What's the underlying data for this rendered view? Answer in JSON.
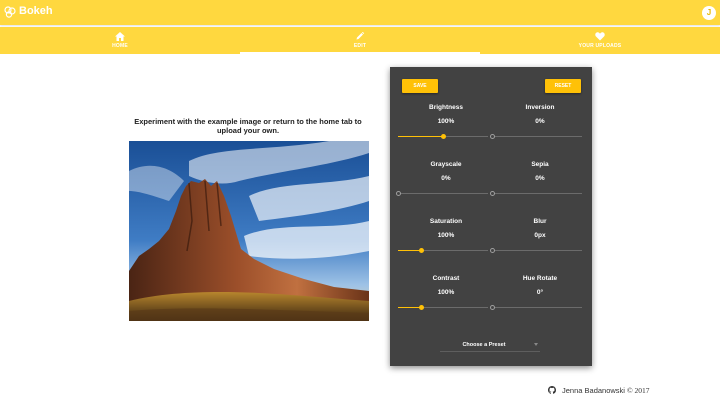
{
  "app": {
    "brand": "Bokeh",
    "logo_icon": "bokeh-logo-icon",
    "avatar_initial": "J"
  },
  "colors": {
    "primary": "#ffd83f",
    "accent": "#ffc107",
    "panel": "#424242"
  },
  "tabs": [
    {
      "label": "HOME",
      "icon": "home-icon",
      "active": false
    },
    {
      "label": "EDIT",
      "icon": "pencil-icon",
      "active": true
    },
    {
      "label": "YOUR UPLOADS",
      "icon": "heart-icon",
      "active": false
    }
  ],
  "main": {
    "intro": "Experiment with the example image or return to the home tab to upload your own.",
    "image_alt_icon": "rock-landscape-image"
  },
  "editor": {
    "save_label": "SAVE",
    "reset_label": "RESET",
    "controls": [
      {
        "label": "Brightness",
        "value": "100%",
        "level": 0.5
      },
      {
        "label": "Inversion",
        "value": "0%",
        "level": 0
      },
      {
        "label": "Grayscale",
        "value": "0%",
        "level": 0
      },
      {
        "label": "Sepia",
        "value": "0%",
        "level": 0
      },
      {
        "label": "Saturation",
        "value": "100%",
        "level": 0.25
      },
      {
        "label": "Blur",
        "value": "0px",
        "level": 0
      },
      {
        "label": "Contrast",
        "value": "100%",
        "level": 0.25
      },
      {
        "label": "Hue Rotate",
        "value": "0°",
        "level": 0
      }
    ],
    "preset_label": "Choose a Preset"
  },
  "footer": {
    "author": "Jenna Badanowski",
    "copyright": "© 2017",
    "github_icon": "github-icon"
  }
}
